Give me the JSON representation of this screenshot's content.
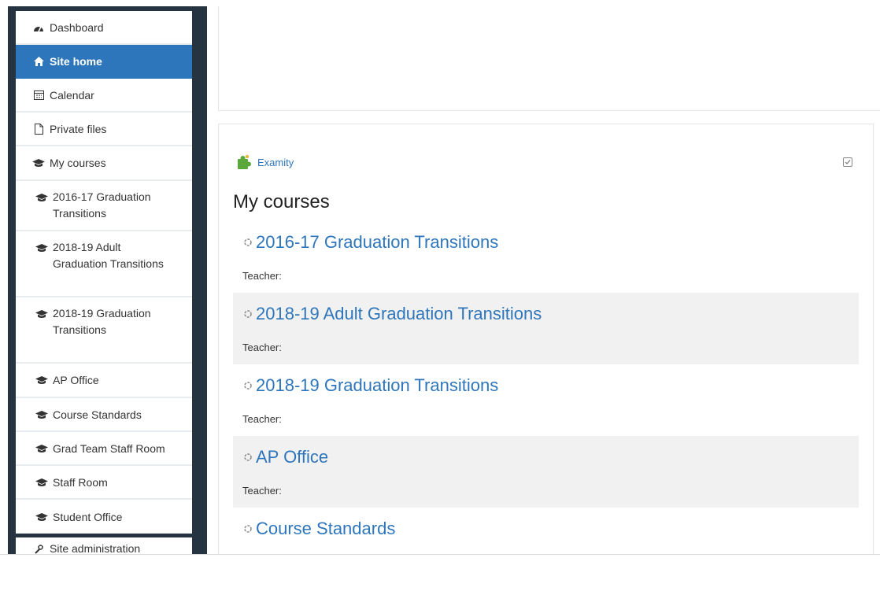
{
  "nav": {
    "items": [
      {
        "label": "Dashboard",
        "icon": "dashboard-icon"
      },
      {
        "label": "Site home",
        "icon": "home-icon",
        "active": true
      },
      {
        "label": "Calendar",
        "icon": "calendar-icon"
      },
      {
        "label": "Private files",
        "icon": "file-icon"
      },
      {
        "label": "My courses",
        "icon": "graduation-cap-icon"
      }
    ],
    "courses": [
      {
        "label": "2016-17 Graduation Transitions"
      },
      {
        "label": "2018-19 Adult Graduation Transitions"
      },
      {
        "label": "2018-19 Graduation Transitions"
      },
      {
        "label": "AP Office"
      },
      {
        "label": "Course Standards"
      },
      {
        "label": "Grad Team Staff Room"
      },
      {
        "label": "Staff Room"
      },
      {
        "label": "Student Office"
      }
    ],
    "site_admin": {
      "label": "Site administration",
      "icon": "wrench-icon"
    }
  },
  "main": {
    "plugin_label": "Examity",
    "section_title": "My courses",
    "teacher_label": "Teacher:",
    "courses": [
      {
        "title": "2016-17 Graduation Transitions"
      },
      {
        "title": "2018-19 Adult Graduation Transitions"
      },
      {
        "title": "2018-19 Graduation Transitions"
      },
      {
        "title": "AP Office"
      },
      {
        "title": "Course Standards"
      }
    ]
  },
  "colors": {
    "accent": "#2e76bb",
    "sidebar_dark": "#263442",
    "row_alt": "#f1f1f1"
  }
}
